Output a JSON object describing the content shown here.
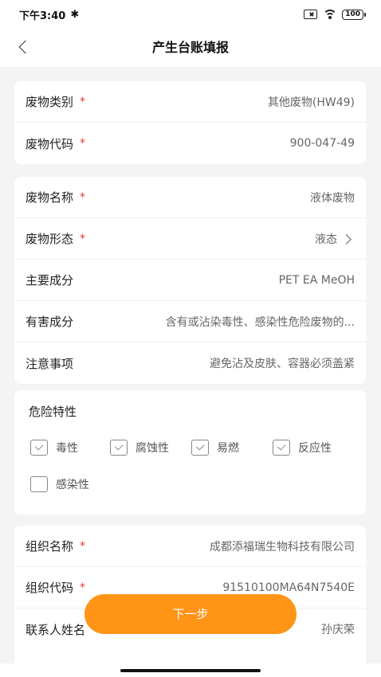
{
  "status_bar": {
    "time": "下午3:40",
    "bluetooth": "✱",
    "battery": "100"
  },
  "header": {
    "title": "产生台账填报"
  },
  "waste_card": [
    {
      "label": "废物类别",
      "required": "*",
      "value": "其他废物(HW49)"
    },
    {
      "label": "废物代码",
      "required": "*",
      "value": "900-047-49"
    }
  ],
  "detail_card": [
    {
      "label": "废物名称",
      "required": "*",
      "value": "液体废物"
    },
    {
      "label": "废物形态",
      "required": "*",
      "value": "液态"
    },
    {
      "label": "主要成分",
      "required": "",
      "value": "PET EA MeOH"
    },
    {
      "label": "有害成分",
      "required": "",
      "value": "含有或沾染毒性、感染性危险废物的..."
    },
    {
      "label": "注意事项",
      "required": "",
      "value": "避免沾及皮肤、容器必须盖紧"
    }
  ],
  "hazard": {
    "title": "危险特性",
    "options": [
      {
        "label": "毒性",
        "checked": true
      },
      {
        "label": "腐蚀性",
        "checked": true
      },
      {
        "label": "易燃",
        "checked": true
      },
      {
        "label": "反应性",
        "checked": true
      },
      {
        "label": "感染性",
        "checked": false
      }
    ]
  },
  "org_card": [
    {
      "label": "组织名称",
      "required": "*",
      "value": "成都添福瑞生物科技有限公司"
    },
    {
      "label": "组织代码",
      "required": "*",
      "value": "91510100MA64N7540E"
    },
    {
      "label": "联系人姓名",
      "required": "",
      "value": "孙庆荣"
    }
  ],
  "footer": {
    "next_label": "下一步"
  },
  "colors": {
    "accent": "#ff9417",
    "required": "#e53935",
    "background": "#f4f4f4"
  }
}
